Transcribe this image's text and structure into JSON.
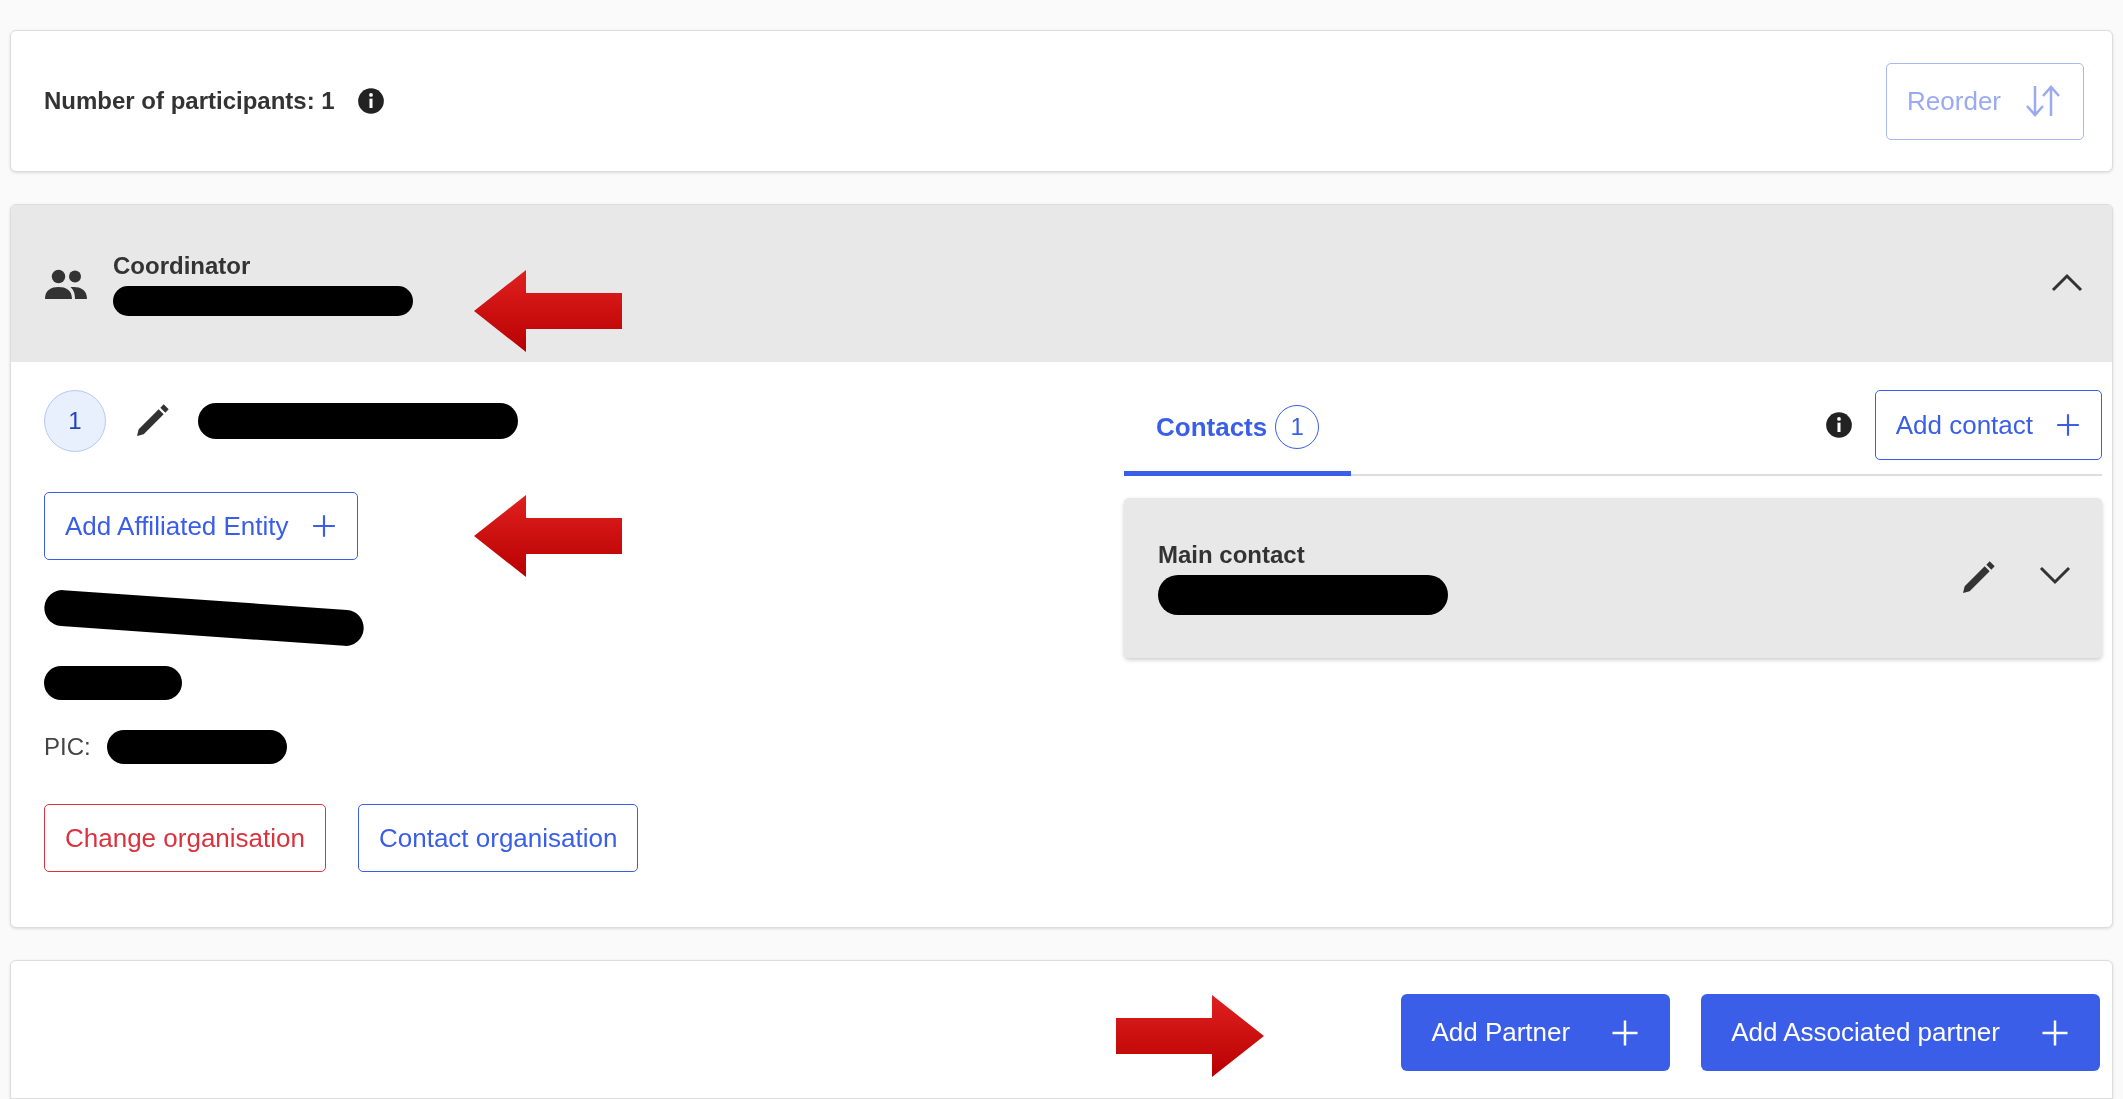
{
  "summary": {
    "label": "Number of participants: 1",
    "reorder_button": {
      "label": "Reorder",
      "disabled": true
    }
  },
  "participant": {
    "role": "Coordinator",
    "name_redacted": true,
    "expanded": true,
    "number": "1",
    "org_name_redacted": true,
    "affiliated_button": "Add Affiliated Entity",
    "details": [
      {
        "kind": "redacted"
      },
      {
        "kind": "redacted_short"
      },
      {
        "kind": "labelled",
        "label": "PIC:"
      }
    ],
    "actions": [
      {
        "label": "Change organisation",
        "kind": "danger"
      },
      {
        "label": "Contact organisation",
        "kind": "outline"
      }
    ],
    "contacts": {
      "tabs": [
        {
          "label": "Contacts",
          "count": "1",
          "selected": true
        }
      ],
      "add_button": "Add contact",
      "items": [
        {
          "title": "Main contact",
          "name_redacted": true,
          "expanded": false
        }
      ]
    }
  },
  "footer_buttons": [
    "Add Partner",
    "Add Associated partner"
  ],
  "annotations": [
    {
      "kind": "left_arrow"
    },
    {
      "kind": "left_arrow"
    },
    {
      "kind": "right_arrow"
    }
  ]
}
